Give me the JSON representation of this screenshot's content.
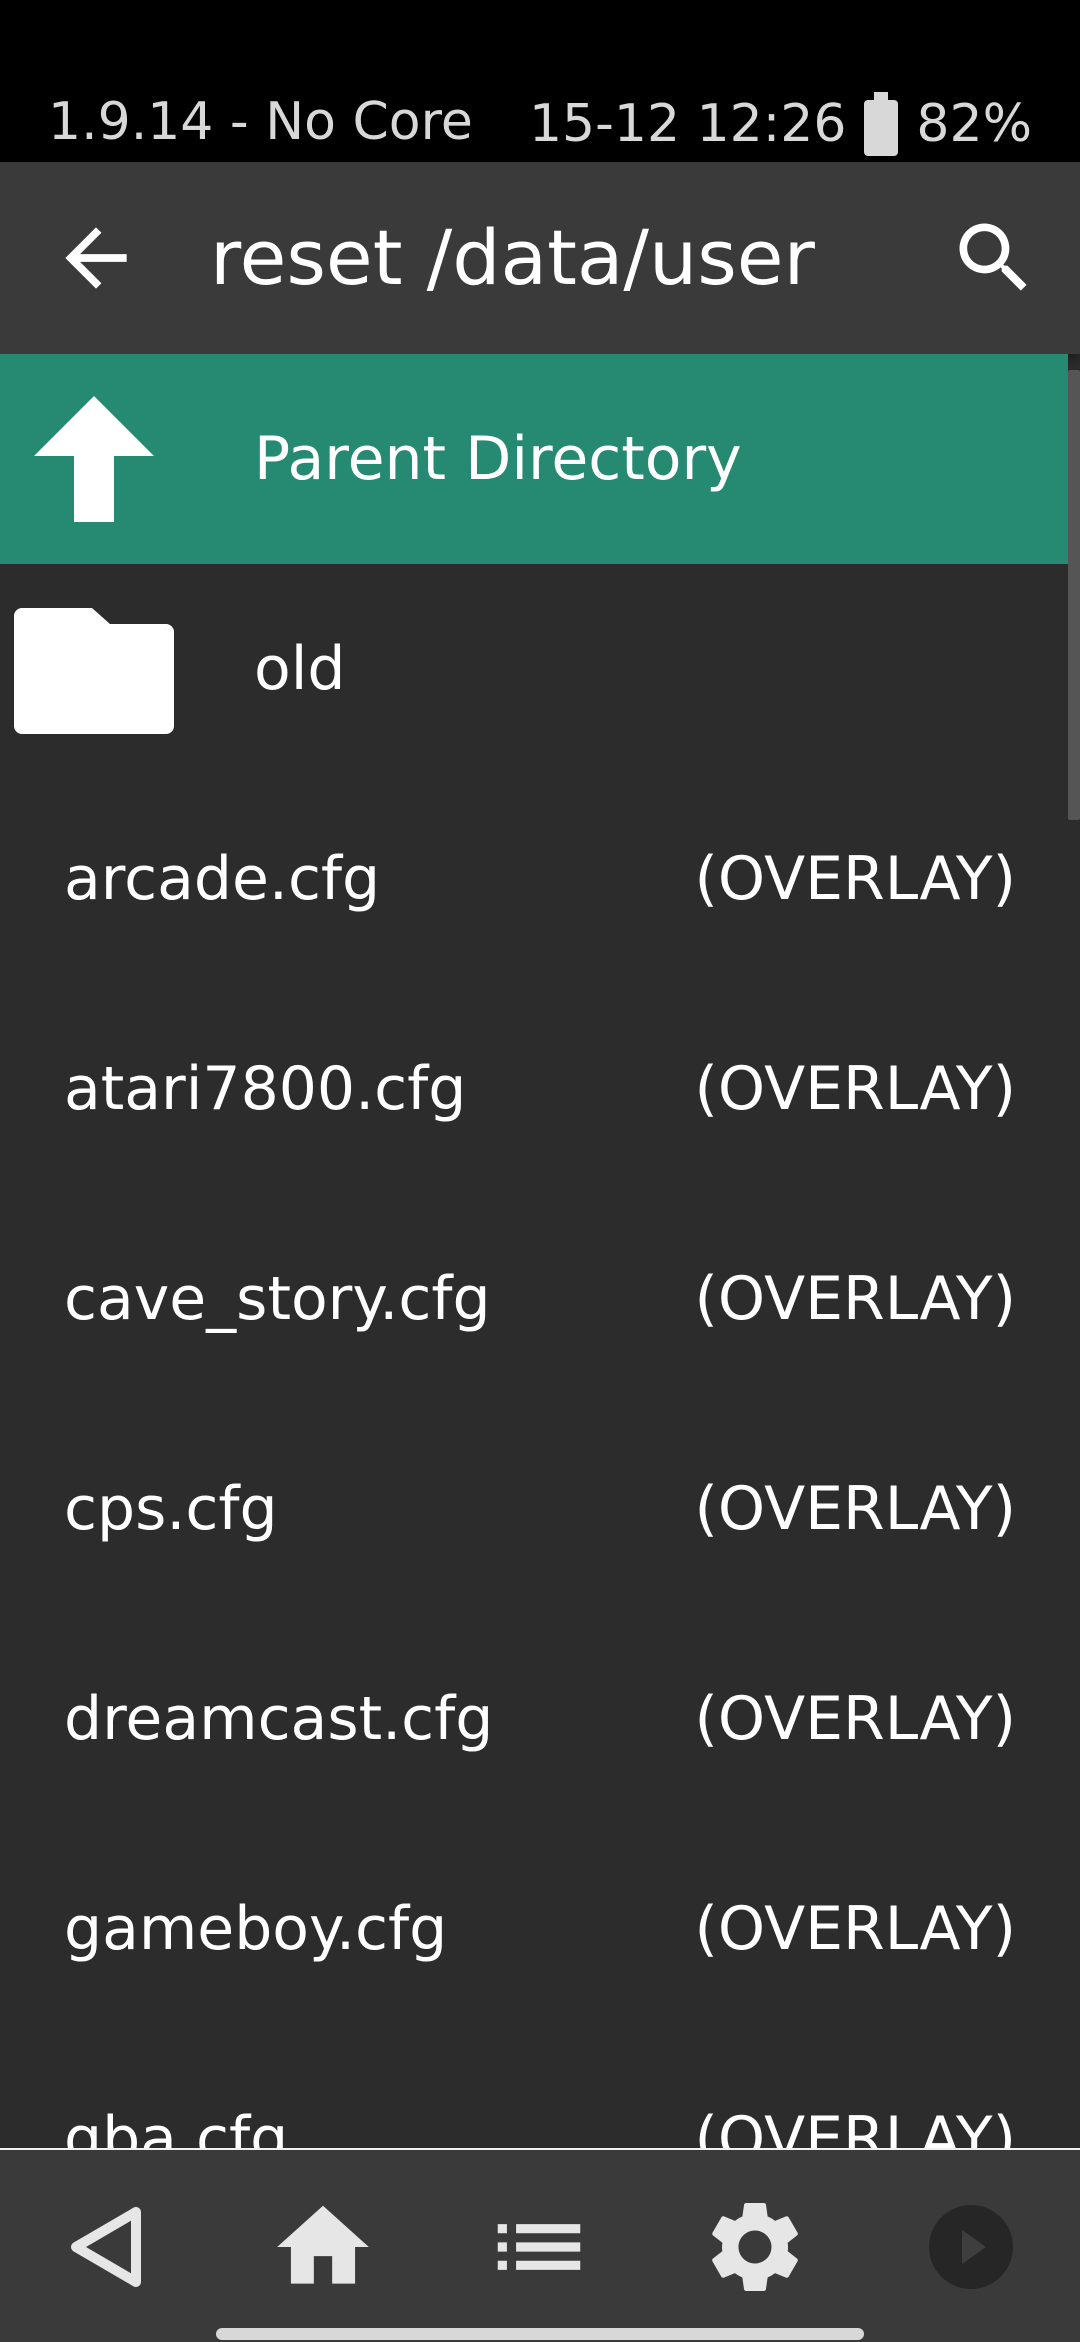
{
  "status_bar": {
    "left_text": "1.9.14 - No Core",
    "datetime": "15-12 12:26",
    "battery": "82%"
  },
  "header": {
    "title": "reset /data/user",
    "back_icon": "arrow-left-icon",
    "search_icon": "search-icon"
  },
  "list": {
    "parent": {
      "label": "Parent Directory",
      "icon": "arrow-up-icon"
    },
    "folder": {
      "label": "old",
      "icon": "folder-icon"
    },
    "files": [
      {
        "name": "arcade.cfg",
        "type": "(OVERLAY)"
      },
      {
        "name": "atari7800.cfg",
        "type": "(OVERLAY)"
      },
      {
        "name": "cave_story.cfg",
        "type": "(OVERLAY)"
      },
      {
        "name": "cps.cfg",
        "type": "(OVERLAY)"
      },
      {
        "name": "dreamcast.cfg",
        "type": "(OVERLAY)"
      },
      {
        "name": "gameboy.cfg",
        "type": "(OVERLAY)"
      },
      {
        "name": "gba.cfg",
        "type": "(OVERLAY)"
      }
    ]
  },
  "bottom_nav": {
    "items": [
      "back-triangle-icon",
      "home-icon",
      "list-icon",
      "settings-gear-icon",
      "play-icon"
    ]
  },
  "colors": {
    "accent": "#268a72",
    "background": "#2c2c2c",
    "header": "#3a3a3a"
  }
}
